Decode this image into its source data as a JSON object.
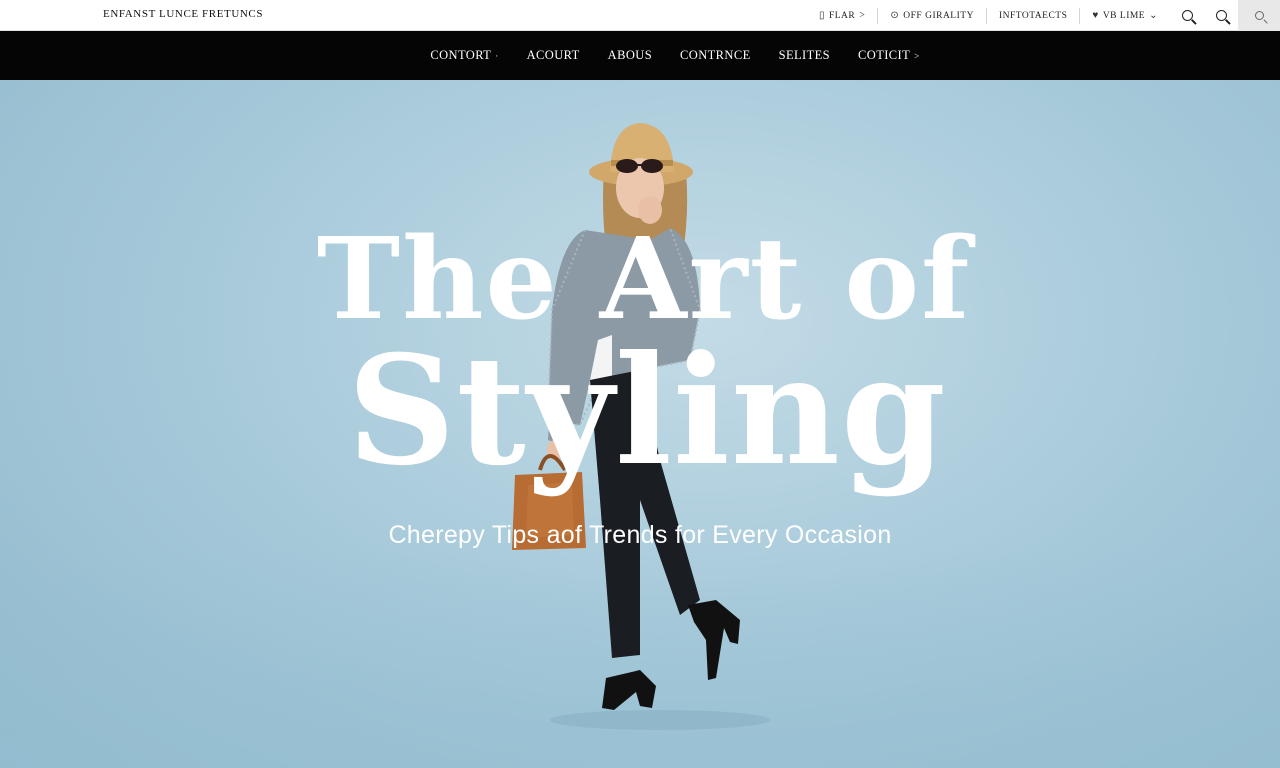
{
  "brand": {
    "name": "ENFANST LUNCE FRETUNCS"
  },
  "utility_bar": {
    "items": [
      {
        "label": "FLAR",
        "icon": "phone-icon",
        "suffix": ">"
      },
      {
        "label": "OFF GIRALITY",
        "icon": "circle-icon"
      },
      {
        "label": "INFTOTAECTS"
      },
      {
        "label": "VB LIME",
        "icon": "bird-icon",
        "suffix": "⌄"
      }
    ],
    "search_icons": [
      "search-icon",
      "search-icon",
      "search-icon"
    ]
  },
  "nav": {
    "items": [
      {
        "label": "CONTORT",
        "caret": "·"
      },
      {
        "label": "ACOURT"
      },
      {
        "label": "ABOUS"
      },
      {
        "label": "CONTRNCE"
      },
      {
        "label": "SELITES"
      },
      {
        "label": "COTICIT",
        "caret": ">"
      }
    ]
  },
  "hero": {
    "title_line1": "The Art of",
    "title_line2": "Styling",
    "subtitle": "Cherepy Tips aof Trends for Every Occasion"
  },
  "colors": {
    "nav_bg": "#050505",
    "hero_bg": "#a9cbdb",
    "text_light": "#ffffff"
  }
}
